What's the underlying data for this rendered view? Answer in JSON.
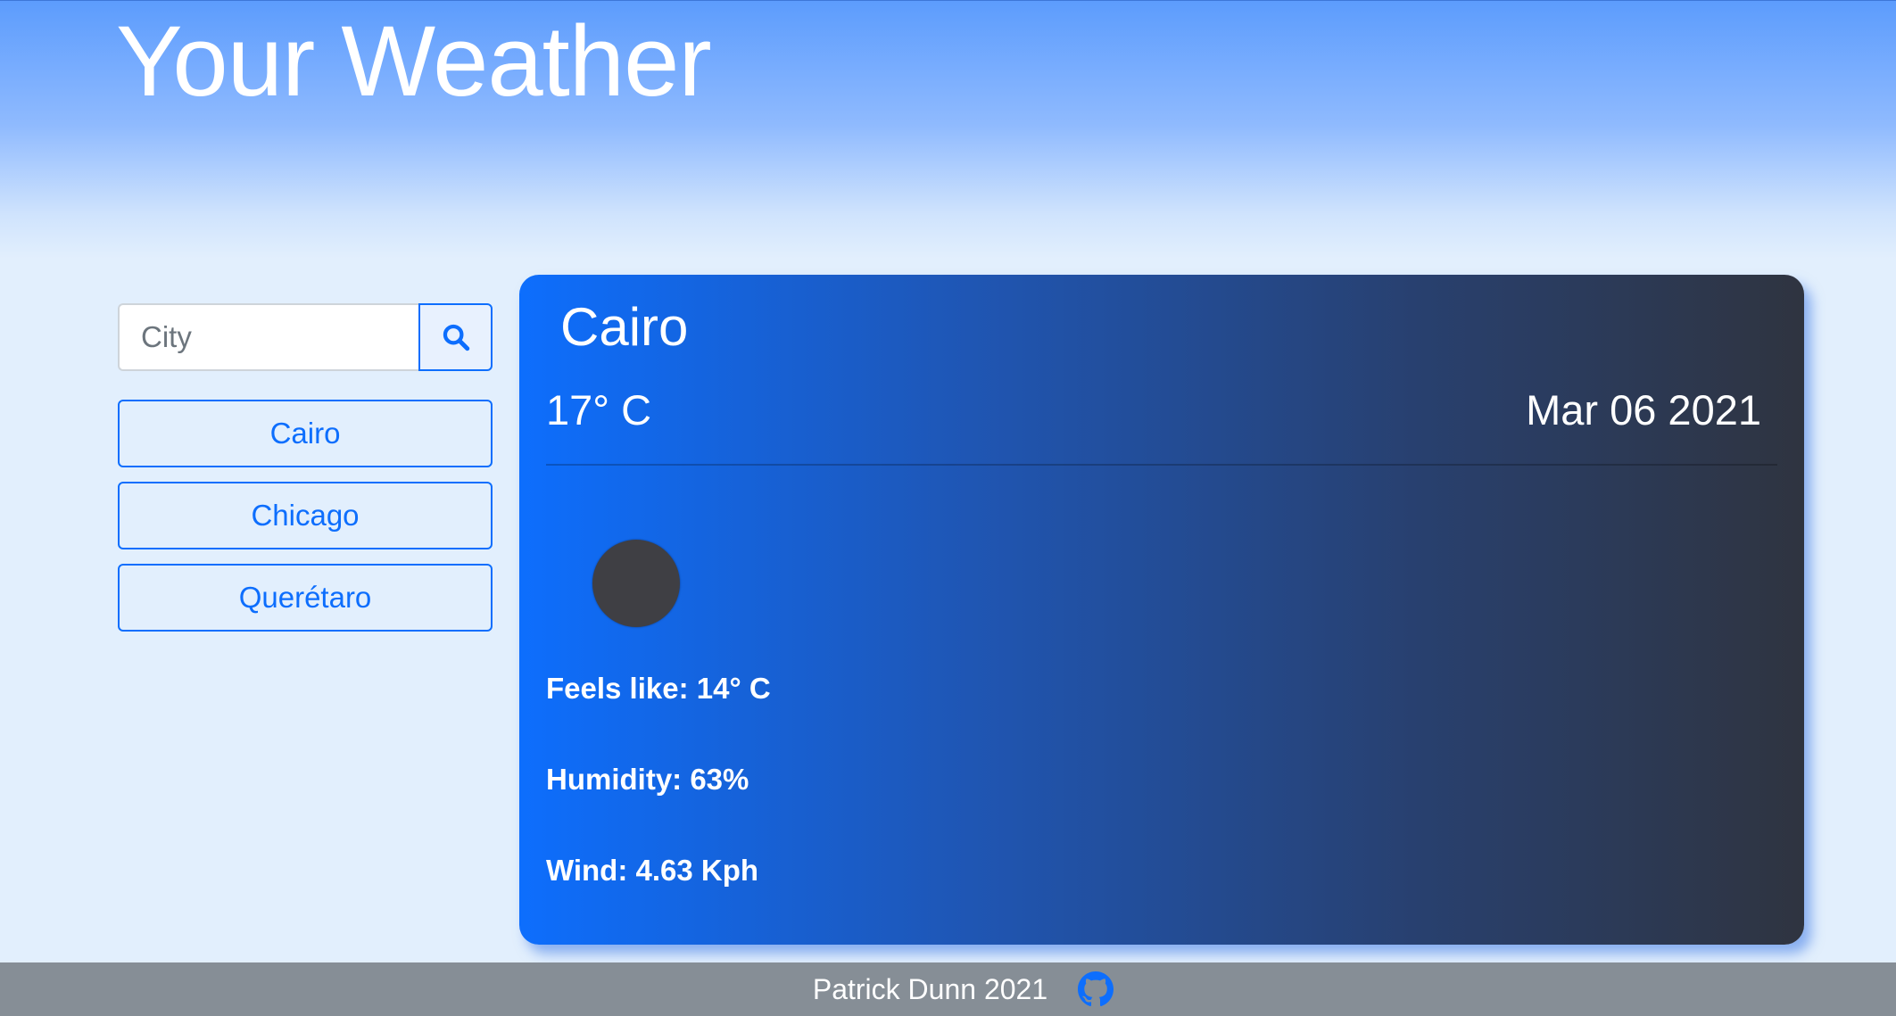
{
  "header": {
    "title": "Your Weather"
  },
  "search": {
    "placeholder": "City",
    "value": "",
    "button_icon": "search-icon"
  },
  "saved_cities": [
    {
      "label": "Cairo"
    },
    {
      "label": "Chicago"
    },
    {
      "label": "Querétaro"
    }
  ],
  "current": {
    "city": "Cairo",
    "temperature": "17° C",
    "date": "Mar 06 2021",
    "icon": "weather-condition-icon",
    "feels_like": "Feels like: 14° C",
    "humidity": "Humidity: 63%",
    "wind": "Wind: 4.63 Kph"
  },
  "footer": {
    "text": "Patrick Dunn 2021",
    "link_icon": "github-icon"
  },
  "colors": {
    "accent": "#0d6efd",
    "card_gradient_start": "#0d6efd",
    "card_gradient_end": "#2f3440",
    "footer_bg": "#868e96"
  }
}
